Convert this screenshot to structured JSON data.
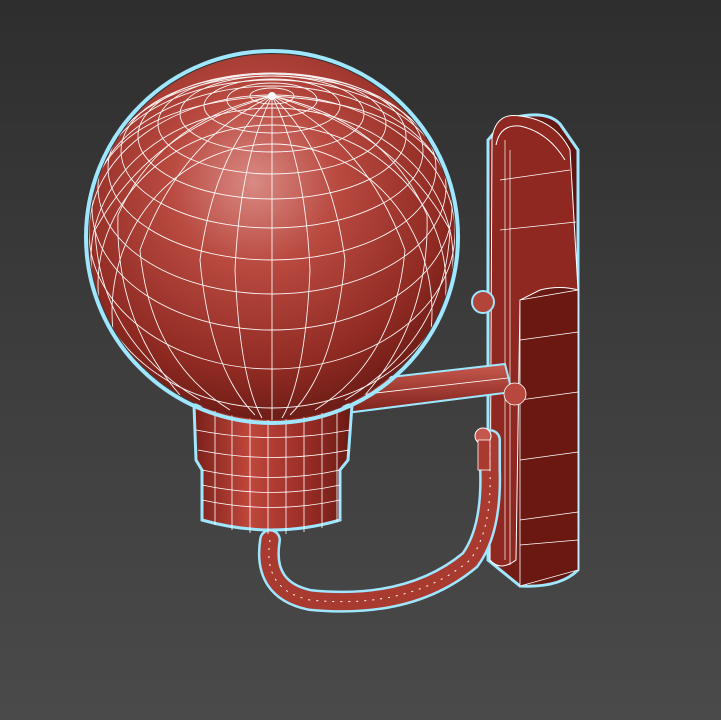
{
  "viewport": {
    "view": "perspective",
    "background_top": "#2e2e2e",
    "background_bottom": "#4a4a4a"
  },
  "model": {
    "icon": "wall-lamp-wireframe-icon",
    "shaded_color": "#b13a30",
    "wire_color": "#ffffff",
    "selection_outline_color": "#9fe6ff",
    "parts": [
      "globe",
      "socket",
      "arm",
      "back-plate",
      "cable",
      "screws"
    ]
  }
}
